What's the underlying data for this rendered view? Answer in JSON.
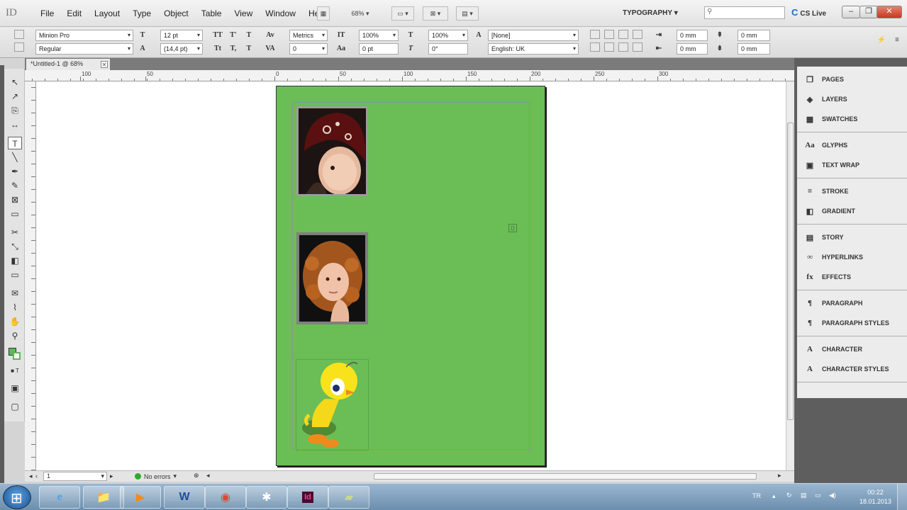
{
  "app": {
    "logo": "ID"
  },
  "menu": [
    "File",
    "Edit",
    "Layout",
    "Type",
    "Object",
    "Table",
    "View",
    "Window",
    "Help"
  ],
  "menubar": {
    "zoom": "68%",
    "workspace": "TYPOGRAPHY",
    "search_placeholder": "",
    "cs_live": "CS Live"
  },
  "control": {
    "font_family": "Minion Pro",
    "font_style": "Regular",
    "font_size": "12 pt",
    "leading": "(14,4 pt)",
    "kerning": "Metrics",
    "tracking": "0",
    "vscale": "100%",
    "hscale": "100%",
    "baseline": "0 pt",
    "skew": "0°",
    "char_style": "[None]",
    "language": "English: UK",
    "indent_left": "0 mm",
    "indent_first": "0 mm",
    "space_before": "0 mm",
    "space_after": "0 mm"
  },
  "document": {
    "tab_title": "*Untitled-1 @ 68%"
  },
  "ruler": {
    "h_labels": [
      "100",
      "50",
      "0",
      "50",
      "100",
      "150",
      "200",
      "250",
      "300"
    ]
  },
  "status": {
    "page": "1",
    "preflight": "No errors"
  },
  "panels": [
    [
      {
        "icon": "pages-icon",
        "glyph": "❒",
        "label": "PAGES"
      },
      {
        "icon": "layers-icon",
        "glyph": "◈",
        "label": "LAYERS"
      },
      {
        "icon": "swatches-icon",
        "glyph": "▦",
        "label": "SWATCHES"
      }
    ],
    [
      {
        "icon": "glyphs-icon",
        "glyph": "Aa",
        "label": "GLYPHS"
      },
      {
        "icon": "text-wrap-icon",
        "glyph": "▣",
        "label": "TEXT WRAP"
      }
    ],
    [
      {
        "icon": "stroke-icon",
        "glyph": "≡",
        "label": "STROKE"
      },
      {
        "icon": "gradient-icon",
        "glyph": "◧",
        "label": "GRADIENT"
      }
    ],
    [
      {
        "icon": "story-icon",
        "glyph": "▤",
        "label": "STORY"
      },
      {
        "icon": "hyperlinks-icon",
        "glyph": "∞",
        "label": "HYPERLINKS"
      },
      {
        "icon": "effects-icon",
        "glyph": "fx",
        "label": "EFFECTS"
      }
    ],
    [
      {
        "icon": "paragraph-icon",
        "glyph": "¶",
        "label": "PARAGRAPH"
      },
      {
        "icon": "paragraph-styles-icon",
        "glyph": "¶",
        "label": "PARAGRAPH STYLES"
      }
    ],
    [
      {
        "icon": "character-icon",
        "glyph": "A",
        "label": "CHARACTER"
      },
      {
        "icon": "character-styles-icon",
        "glyph": "A",
        "label": "CHARACTER STYLES"
      }
    ]
  ],
  "taskbar": {
    "lang": "TR",
    "time": "00:22",
    "date": "18.01.2013"
  },
  "colors": {
    "page_green": "#6bbd55",
    "accent": "#1a6fc9"
  }
}
